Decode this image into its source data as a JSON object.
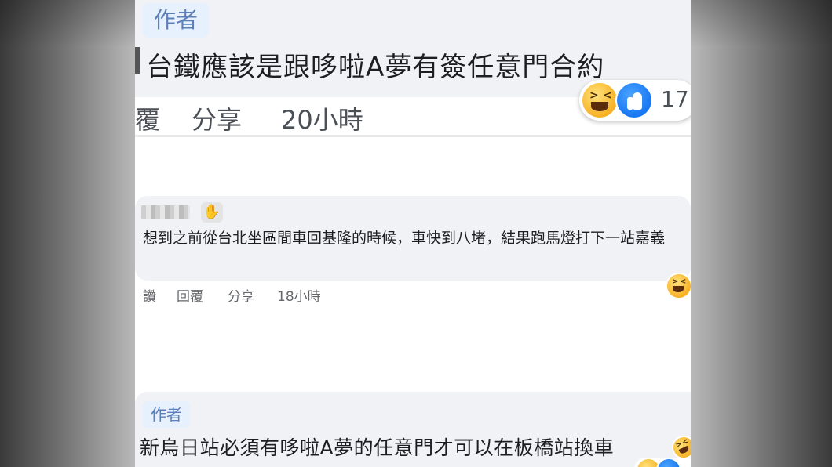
{
  "comment1": {
    "author_badge": "作者",
    "text": "台鐵應該是跟哆啦A夢有簽任意門合約",
    "actions": [
      "覆",
      "分享",
      "20小時"
    ],
    "reaction_count": "17",
    "reactions": [
      "laugh-icon",
      "like-icon"
    ]
  },
  "comment2": {
    "name_blurred": true,
    "badge_icon": "waving-hand-icon",
    "badge_glyph": "✋",
    "text": "想到之前從台北坐區間車回基隆的時候，車快到八堵，結果跑馬燈打下一站嘉義",
    "actions": [
      "讚",
      "回覆",
      "分享",
      "18小時"
    ],
    "reaction": "laugh-icon"
  },
  "comment3": {
    "author_badge": "作者",
    "text": "新烏日站必須有哆啦A夢的任意門才可以在板橋站換車",
    "inline_emoji": "rofl-icon"
  },
  "colors": {
    "bubble": "#f0f2f5",
    "author_badge_bg": "#e7f0fd",
    "author_badge_text": "#5b7fb8",
    "like_blue": "#1877f2",
    "laugh_yellow": "#f7b125"
  }
}
